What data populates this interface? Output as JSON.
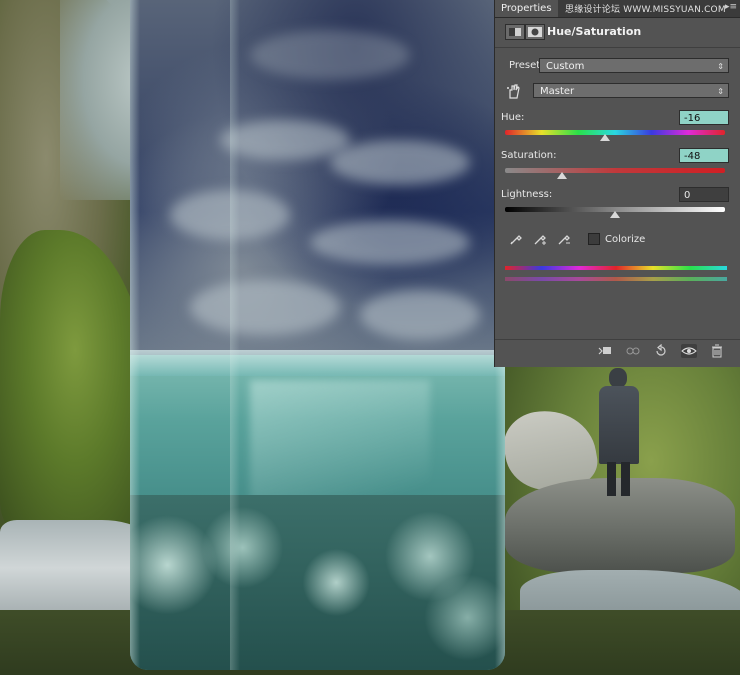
{
  "panel": {
    "tab_label": "Properties",
    "tab_menu_glyph": "▸≡",
    "watermark": "思缘设计论坛 WWW.MISSYUAN.COM",
    "adjustment_title": "Hue/Saturation",
    "preset_label": "Preset:",
    "preset_value": "Custom",
    "channel_value": "Master",
    "hue_label": "Hue:",
    "hue_value": "-16",
    "hue_position": 0.455,
    "saturation_label": "Saturation:",
    "saturation_value": "-48",
    "saturation_position": 0.26,
    "lightness_label": "Lightness:",
    "lightness_value": "0",
    "lightness_position": 0.5,
    "colorize_label": "Colorize",
    "colorize_checked": false
  },
  "icons": {
    "layer_icon": "adjustment-layer-icon",
    "mask_icon": "mask-icon",
    "hand_icon": "targeted-adjustment-hand-icon",
    "eyedropper": "eyedropper-icon",
    "eyedropper_plus": "eyedropper-plus-icon",
    "eyedropper_minus": "eyedropper-minus-icon",
    "clip": "clip-to-layer-icon",
    "view_previous": "view-previous-state-icon",
    "reset": "reset-icon",
    "visibility": "eye-icon",
    "delete": "trash-icon"
  },
  "colors": {
    "highlight_input": "#8fd3c6",
    "panel_bg": "#535353"
  }
}
